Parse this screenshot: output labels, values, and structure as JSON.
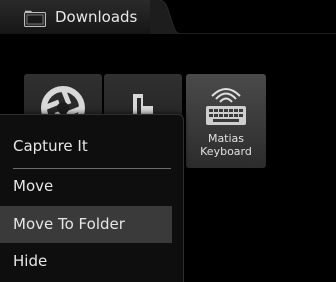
{
  "tab": {
    "title": "Downloads",
    "icon": "folder-icon"
  },
  "icons": [
    {
      "name": "aperture-app-icon",
      "label": ""
    },
    {
      "name": "thumb-app-icon",
      "label": ""
    },
    {
      "name": "keyboard-app-icon",
      "label": "Matias\nKeyboard",
      "label_line1": "Matias",
      "label_line2": "Keyboard"
    }
  ],
  "menu": {
    "items": [
      {
        "label": "Capture It"
      },
      {
        "label": "Move"
      },
      {
        "label": "Move To Folder",
        "highlighted": true
      },
      {
        "label": "Hide"
      }
    ]
  },
  "colors": {
    "background": "#000000",
    "menu_bg": "#0e0e0e",
    "highlight": "#3a3a3a",
    "text": "#e6e6e6"
  }
}
